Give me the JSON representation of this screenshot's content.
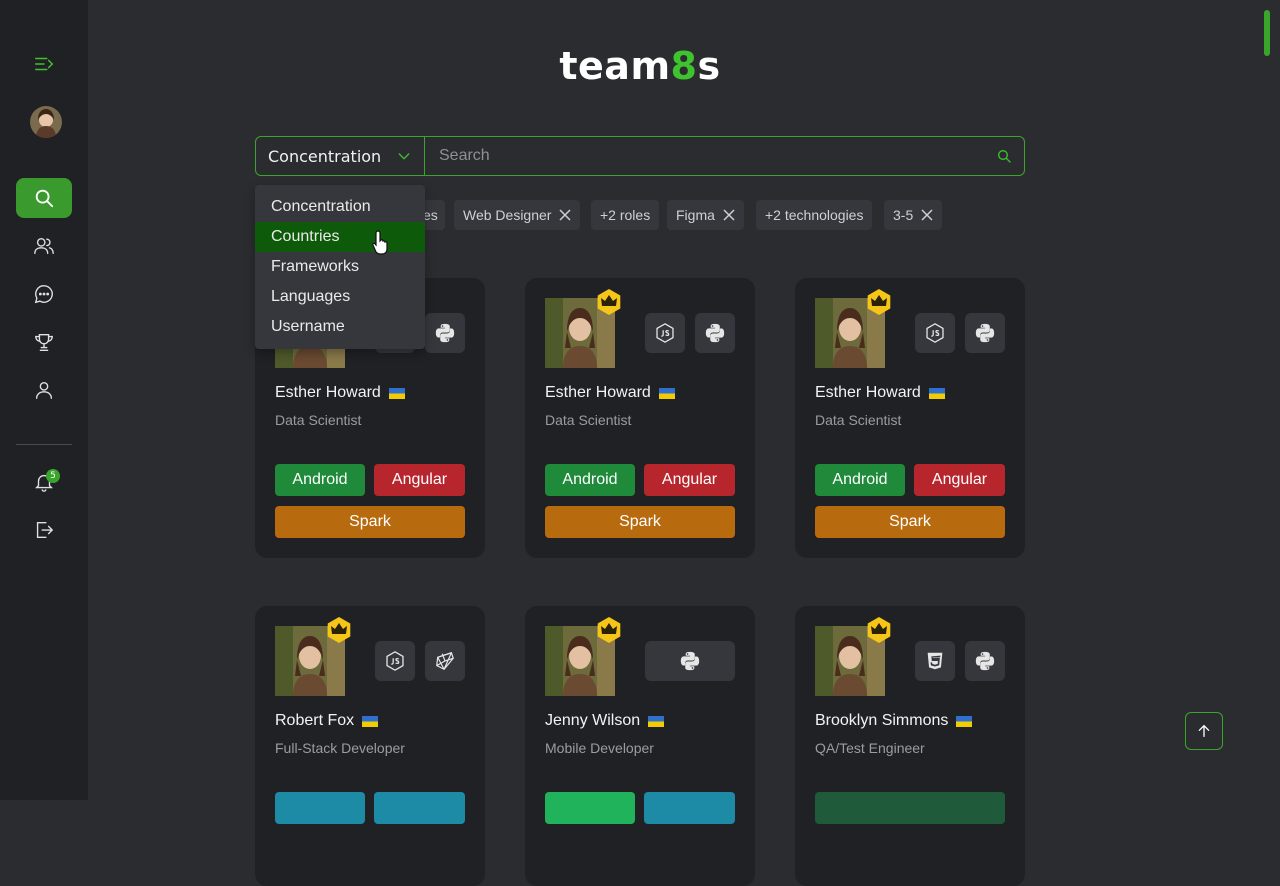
{
  "app": {
    "logo_prefix": "team",
    "logo_accent": "8",
    "logo_suffix": "s"
  },
  "sidebar": {
    "items": [
      {
        "name": "menu-toggle-icon"
      },
      {
        "name": "avatar"
      },
      {
        "name": "search-icon",
        "active": true
      },
      {
        "name": "users-icon"
      },
      {
        "name": "chat-icon"
      },
      {
        "name": "trophy-icon"
      },
      {
        "name": "profile-icon"
      },
      {
        "name": "bell-icon"
      },
      {
        "name": "logout-icon"
      }
    ],
    "notification_count": "5"
  },
  "search": {
    "filter_label": "Concentration",
    "placeholder": "Search"
  },
  "dropdown": {
    "options": [
      "Concentration",
      "Countries",
      "Frameworks",
      "Languages",
      "Username"
    ],
    "highlighted": "Countries"
  },
  "chips": [
    {
      "label": "es",
      "removable": false
    },
    {
      "label": "Web Designer",
      "removable": true
    },
    {
      "label": "+2 roles",
      "removable": false
    },
    {
      "label": "Figma",
      "removable": true
    },
    {
      "label": "+2 technologies",
      "removable": false
    },
    {
      "label": "3-5",
      "removable": true
    }
  ],
  "colors": {
    "accent": "#3aa52b",
    "android": "#1f8a3a",
    "angular": "#b8262d",
    "spark": "#b86a0e"
  },
  "cards": [
    {
      "name": "Esther Howard",
      "role": "Data Scientist",
      "tech": [
        "nodejs-icon",
        "python-icon"
      ],
      "tags": [
        {
          "label": "Android",
          "color": "#1f8a3a"
        },
        {
          "label": "Angular",
          "color": "#b8262d"
        },
        {
          "label": "Spark",
          "color": "#b86a0e"
        }
      ]
    },
    {
      "name": "Esther Howard",
      "role": "Data Scientist",
      "tech": [
        "nodejs-icon",
        "python-icon"
      ],
      "tags": [
        {
          "label": "Android",
          "color": "#1f8a3a"
        },
        {
          "label": "Angular",
          "color": "#b8262d"
        },
        {
          "label": "Spark",
          "color": "#b86a0e"
        }
      ]
    },
    {
      "name": "Esther Howard",
      "role": "Data Scientist",
      "tech": [
        "nodejs-icon",
        "python-icon"
      ],
      "tags": [
        {
          "label": "Android",
          "color": "#1f8a3a"
        },
        {
          "label": "Angular",
          "color": "#b8262d"
        },
        {
          "label": "Spark",
          "color": "#b86a0e"
        }
      ]
    },
    {
      "name": "Robert Fox",
      "role": "Full-Stack Developer",
      "tech": [
        "nodejs-icon",
        "ruby-icon"
      ],
      "tags": [
        {
          "label": "",
          "color": "#1d8aa6"
        },
        {
          "label": "",
          "color": "#1d8aa6"
        }
      ]
    },
    {
      "name": "Jenny Wilson",
      "role": "Mobile Developer",
      "tech": [
        "python-icon"
      ],
      "tags": [
        {
          "label": "",
          "color": "#21b35c"
        },
        {
          "label": "",
          "color": "#1d8aa6"
        }
      ]
    },
    {
      "name": "Brooklyn Simmons",
      "role": "QA/Test Engineer",
      "tech": [
        "html5-icon",
        "python-icon"
      ],
      "tags": [
        {
          "label": "",
          "color": "#1f5a3a"
        }
      ]
    }
  ]
}
